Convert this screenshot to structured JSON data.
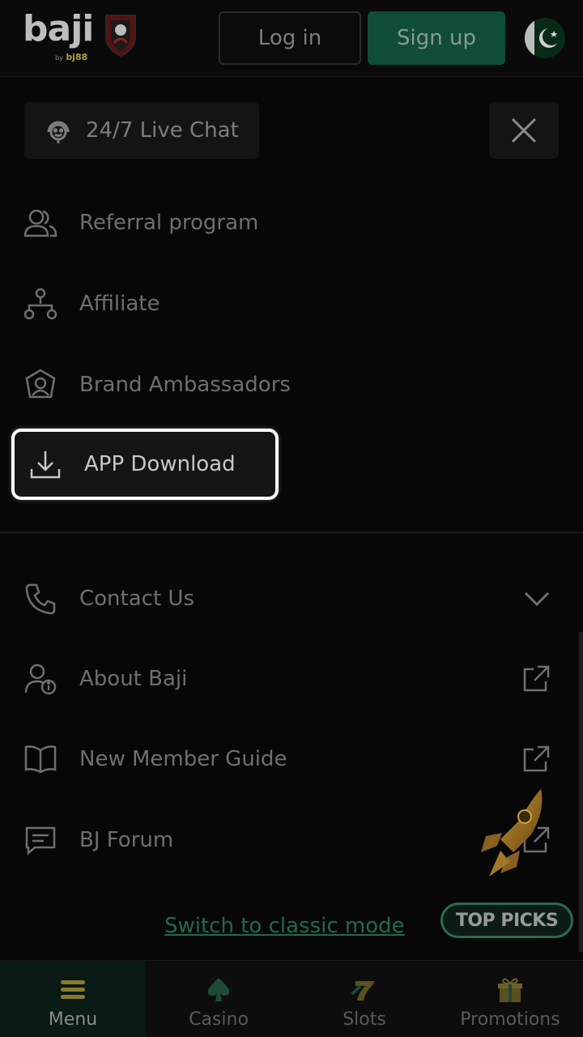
{
  "header": {
    "logo_text": "baji",
    "logo_sub_prefix": "by",
    "logo_sub_brand": "bj88",
    "login_label": "Log in",
    "signup_label": "Sign up"
  },
  "drawer": {
    "livechat_label": "24/7 Live Chat",
    "items": [
      {
        "label": "Referral program",
        "icon": "users-icon"
      },
      {
        "label": "Affiliate",
        "icon": "network-icon"
      },
      {
        "label": "Brand Ambassadors",
        "icon": "ambassador-icon"
      },
      {
        "label": "APP Download",
        "icon": "download-icon"
      }
    ],
    "info_items": [
      {
        "label": "Contact Us",
        "icon": "phone-icon",
        "right_icon": "chevron-down-icon"
      },
      {
        "label": "About Baji",
        "icon": "user-info-icon",
        "right_icon": "external-link-icon"
      },
      {
        "label": "New Member Guide",
        "icon": "book-icon",
        "right_icon": "external-link-icon"
      },
      {
        "label": "BJ Forum",
        "icon": "chat-icon",
        "right_icon": "external-link-icon"
      }
    ],
    "switch_label": "Switch to classic mode",
    "top_picks_label": "TOP PICKS"
  },
  "bottom_nav": [
    {
      "label": "Menu",
      "icon": "menu-icon",
      "active": true
    },
    {
      "label": "Casino",
      "icon": "casino-icon"
    },
    {
      "label": "Slots",
      "icon": "slots-icon"
    },
    {
      "label": "Promotions",
      "icon": "gift-icon"
    }
  ],
  "colors": {
    "accent": "#0f4d36",
    "link": "#1f6a4a",
    "highlight_border": "#ffffff"
  }
}
